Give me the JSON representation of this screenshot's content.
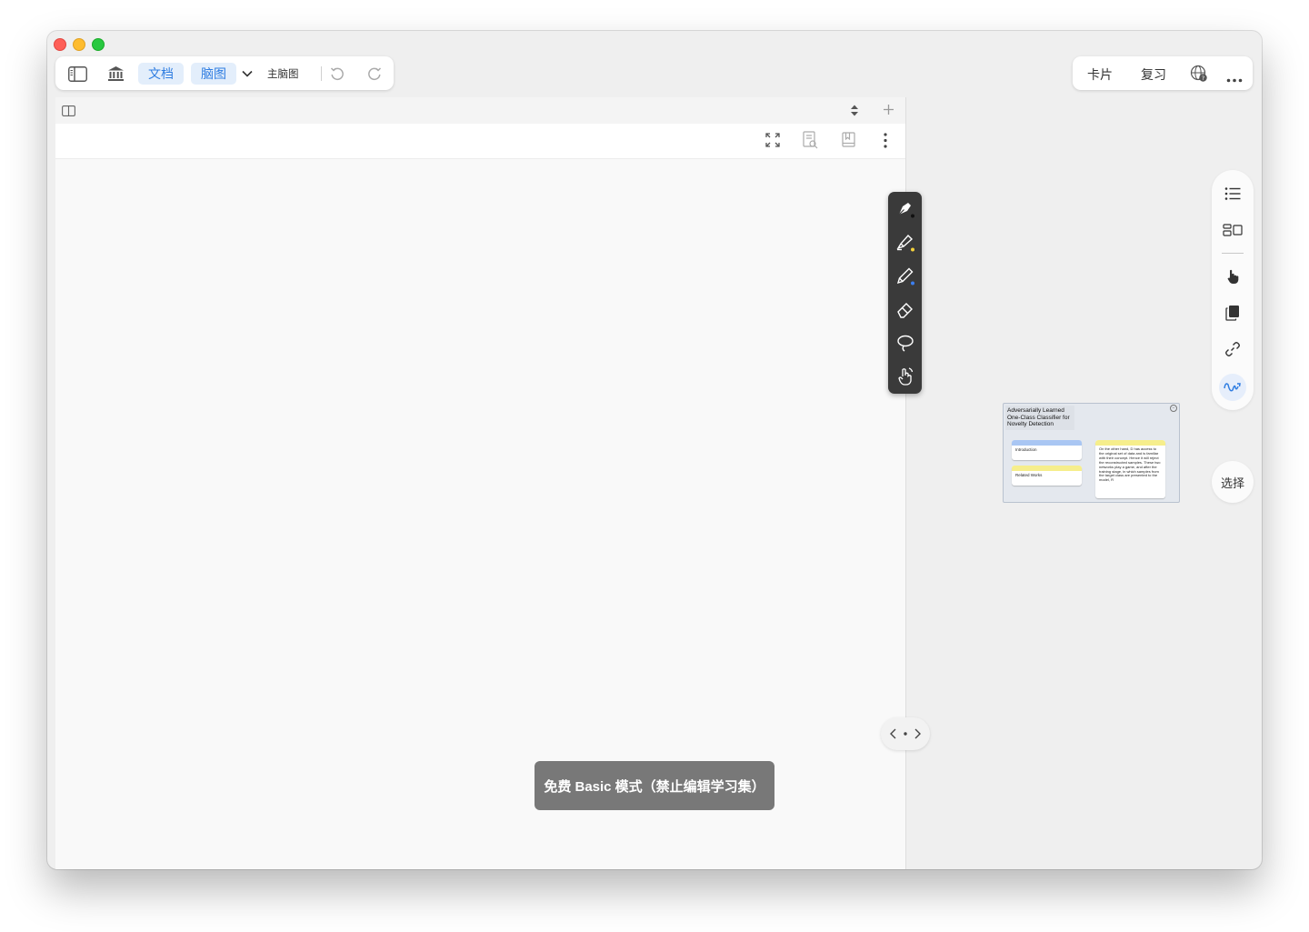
{
  "toolbar": {
    "tab_document": "文档",
    "tab_mindmap": "脑图",
    "mindmap_selector": "主脑图"
  },
  "topright": {
    "cards": "卡片",
    "review": "复习"
  },
  "toast": {
    "text": "免费 Basic 模式（禁止编辑学习集）"
  },
  "right_rail": {
    "select_label": "选择"
  },
  "mindmap_preview": {
    "title": "Adversarially Learned One-Class Classifier for Novelty Detection",
    "nodes": [
      "Introduction",
      "Related Works"
    ],
    "note_text": "On the other hand, D has access to the original set of data and is familiar with their concept. Hence it will reject the reconstructed samples. These two networks play a game, and after the training stage, in which samples from the target class are presented to the model, R"
  },
  "colors": {
    "accent_blue": "#2f7de1",
    "pill_bg": "#e3eefb",
    "pen_toolbar_bg": "#3a3a3a",
    "toast_bg": "#787878",
    "note_blue": "#a9c6f3",
    "note_yellow": "#f6ee8c"
  }
}
